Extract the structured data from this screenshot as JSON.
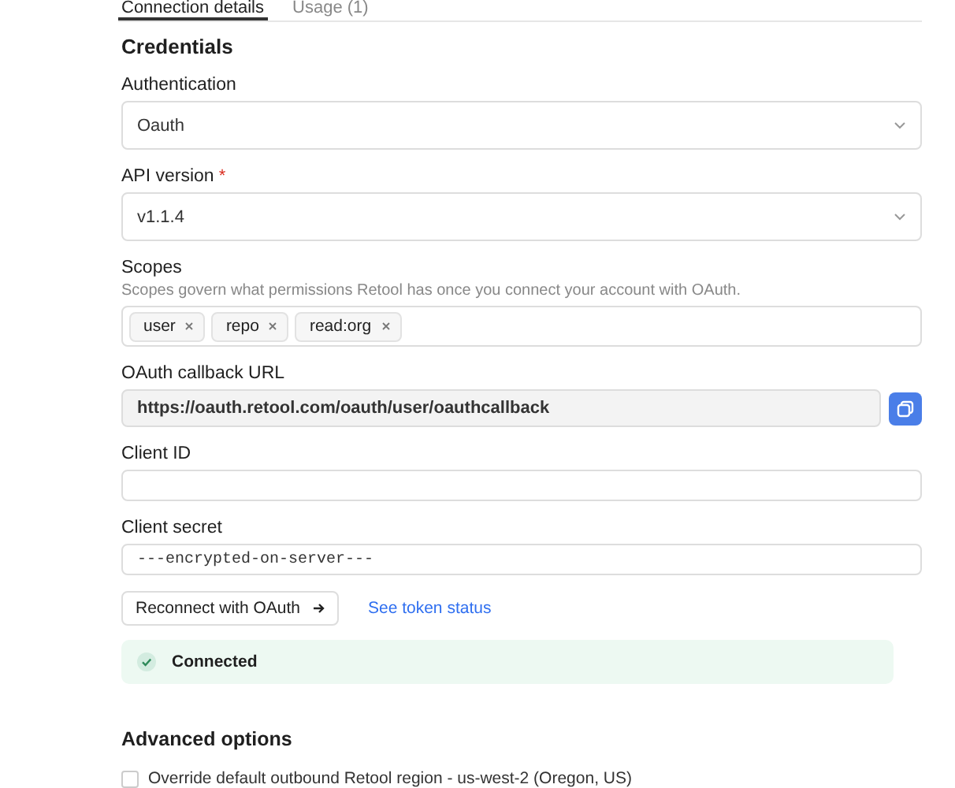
{
  "tabs": [
    {
      "label": "Connection details",
      "selected": true
    },
    {
      "label": "Usage (1)",
      "selected": false
    }
  ],
  "section_title": "Credentials",
  "authentication": {
    "label": "Authentication",
    "value": "Oauth"
  },
  "api_version": {
    "label": "API version",
    "required": true,
    "required_mark": "*",
    "value": "v1.1.4"
  },
  "scopes": {
    "label": "Scopes",
    "help": "Scopes govern what permissions Retool has once you connect your account with OAuth.",
    "tags": [
      "user",
      "repo",
      "read:org"
    ]
  },
  "callback_url": {
    "label": "OAuth callback URL",
    "value": "https://oauth.retool.com/oauth/user/oauthcallback"
  },
  "client_id": {
    "label": "Client ID"
  },
  "client_secret": {
    "label": "Client secret",
    "value": "---encrypted-on-server---"
  },
  "reconnect_button": "Reconnect with OAuth",
  "token_link": "See token status",
  "status": {
    "text": "Connected",
    "connected": true
  },
  "advanced": {
    "title": "Advanced options",
    "override": {
      "label": "Override default outbound Retool region - us-west-2 (Oregon, US)",
      "checked": false
    }
  }
}
